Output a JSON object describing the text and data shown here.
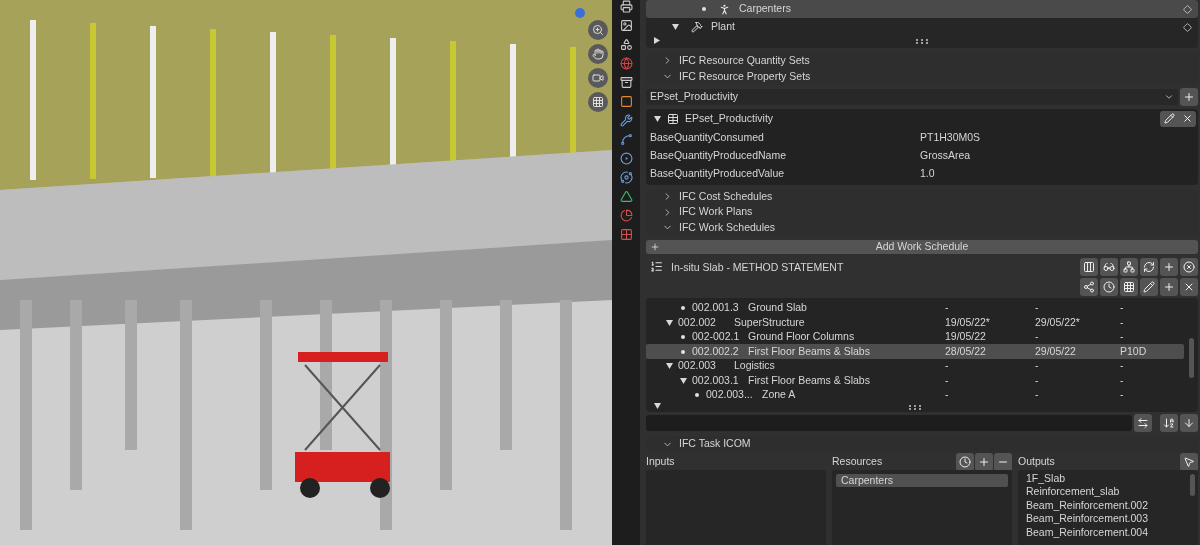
{
  "resource_tree": {
    "items": [
      {
        "children": [
          {
            "name": "Carpenters",
            "kind": "leaf",
            "selected": true
          }
        ]
      },
      {
        "name": "Plant",
        "kind": "group",
        "expanded": true,
        "selected": false
      }
    ]
  },
  "panels_top": [
    {
      "title": "IFC Resource Quantity Sets",
      "expanded": false
    },
    {
      "title": "IFC Resource Property Sets",
      "expanded": true
    }
  ],
  "pset_dropdown": {
    "value": "EPset_Productivity"
  },
  "pset": {
    "title": "EPset_Productivity",
    "expanded": true,
    "properties": [
      {
        "name": "BaseQuantityConsumed",
        "value": "PT1H30M0S"
      },
      {
        "name": "BaseQuantityProducedName",
        "value": "GrossArea"
      },
      {
        "name": "BaseQuantityProducedValue",
        "value": "1.0"
      }
    ]
  },
  "panels_middle": [
    {
      "title": "IFC Cost Schedules",
      "expanded": false
    },
    {
      "title": "IFC Work Plans",
      "expanded": false
    },
    {
      "title": "IFC Work Schedules",
      "expanded": true
    }
  ],
  "add_work_schedule": "Add Work Schedule",
  "work_schedule": {
    "title": "In-situ Slab - METHOD STATEMENT",
    "tasks": [
      {
        "children": [
          {
            "code": "002.001.3",
            "name": "Ground Slab",
            "kind": "leaf",
            "selected": false,
            "column_3": "-",
            "column_4": "-",
            "column_5": "-"
          }
        ]
      },
      {
        "code": "002.002",
        "name": "SuperStructure",
        "kind": "group",
        "expanded": true,
        "selected": false,
        "column_3": "19/05/22*",
        "column_4": "29/05/22*",
        "column_5": "-",
        "children": [
          {
            "code": "002-002.1",
            "name": "Ground Floor Columns",
            "kind": "leaf",
            "selected": false,
            "column_3": "19/05/22",
            "column_4": "-",
            "column_5": "-"
          },
          {
            "code": "002.002.2",
            "name": "First Floor Beams & Slabs",
            "kind": "leaf",
            "selected": true,
            "column_3": "28/05/22",
            "column_4": "29/05/22",
            "column_5": "P10D"
          }
        ]
      },
      {
        "code": "002.003",
        "name": "Logistics",
        "kind": "group",
        "expanded": true,
        "selected": false,
        "column_3": "-",
        "column_4": "-",
        "column_5": "-",
        "children": [
          {
            "code": "002.003.1",
            "name": "First Floor Beams & Slabs",
            "kind": "group",
            "expanded": true,
            "selected": false,
            "column_3": "-",
            "column_4": "-",
            "column_5": "-",
            "children": [
              {
                "code": "002.003...",
                "name": "Zone A",
                "kind": "leaf",
                "selected": false,
                "column_3": "-",
                "column_4": "-",
                "column_5": "-"
              }
            ]
          }
        ]
      }
    ]
  },
  "icom_panel": {
    "title": "IFC Task ICOM",
    "expanded": true
  },
  "icom": {
    "inputs": {
      "label": "Inputs"
    },
    "resources": {
      "label": "Resources",
      "items": [
        {
          "name": "Carpenters",
          "selected": true
        }
      ]
    },
    "outputs": {
      "label": "Outputs",
      "items": [
        {
          "name": "1F_Slab",
          "selected": false
        },
        {
          "name": "Reinforcement_slab",
          "selected": false
        },
        {
          "name": "Beam_Reinforcement.002",
          "selected": false
        },
        {
          "name": "Beam_Reinforcement.003",
          "selected": false
        },
        {
          "name": "Beam_Reinforcement.004",
          "selected": false
        }
      ]
    }
  }
}
